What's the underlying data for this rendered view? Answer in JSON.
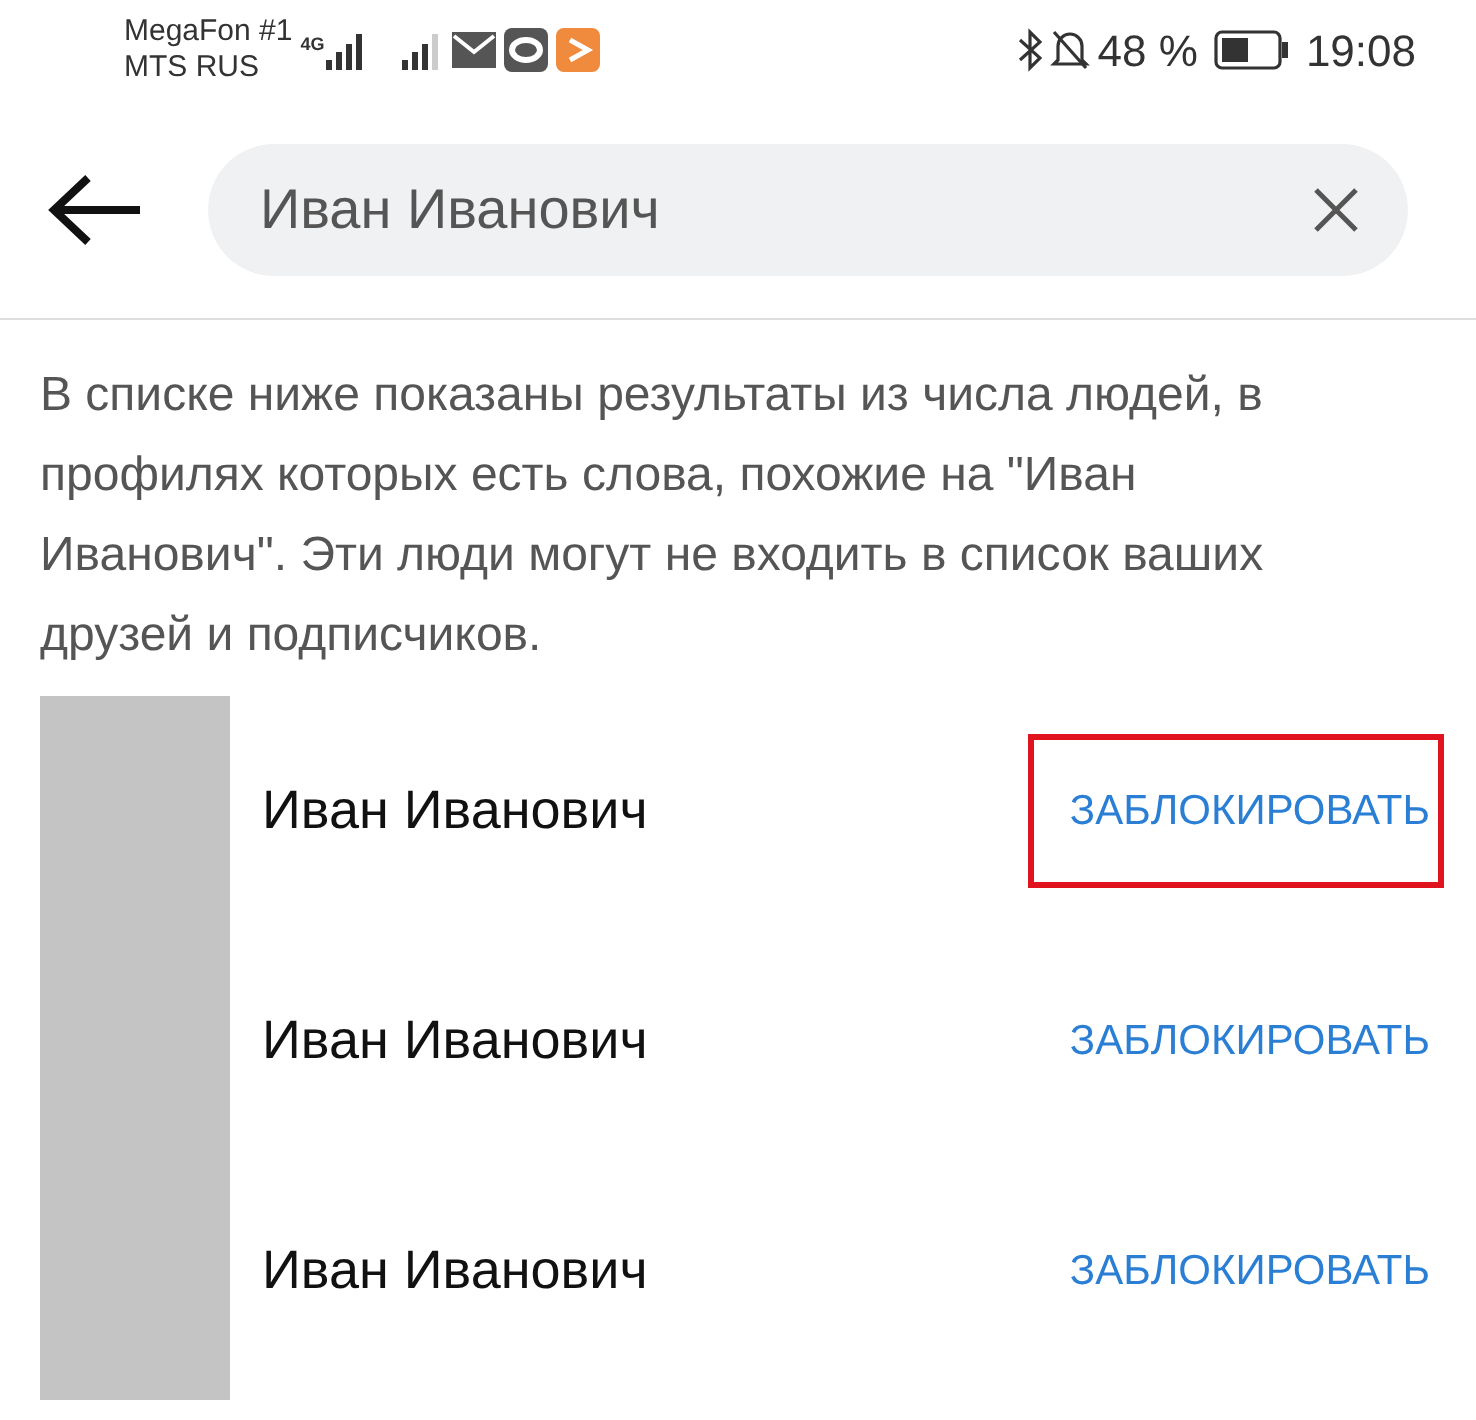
{
  "status_bar": {
    "carrier_1": "MegaFon #1",
    "carrier_2": "MTS RUS",
    "network": "4G",
    "battery": "48 %",
    "time": "19:08"
  },
  "search": {
    "value": "Иван Иванович"
  },
  "notice": "В списке ниже показаны результаты из числа людей, в профилях которых есть слова, похожие на \"Иван Иванович\". Эти люди могут не входить в список ваших друзей и подписчиков.",
  "results": [
    {
      "name": "Иван Иванович",
      "action": "ЗАБЛОКИРОВАТЬ",
      "highlighted": true
    },
    {
      "name": "Иван Иванович",
      "action": "ЗАБЛОКИРОВАТЬ",
      "highlighted": false
    },
    {
      "name": "Иван Иванович",
      "action": "ЗАБЛОКИРОВАТЬ",
      "highlighted": false
    }
  ]
}
